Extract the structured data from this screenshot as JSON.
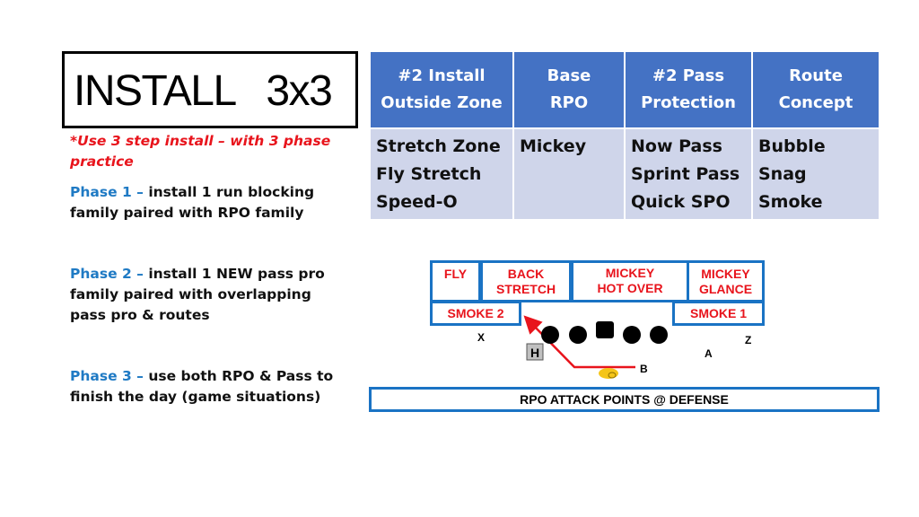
{
  "title": "INSTALL   3x3",
  "notes": {
    "intro": "*Use 3 step install – with 3 phase practice",
    "phases": [
      {
        "label": "Phase 1 –",
        "text": " install 1 run blocking family paired with RPO family"
      },
      {
        "label": "Phase 2 –",
        "text": " install 1 NEW pass pro family paired with overlapping pass pro & routes"
      },
      {
        "label": "Phase 3 –",
        "text": " use both RPO & Pass to finish the day (game situations)"
      }
    ]
  },
  "table": {
    "headers": [
      [
        "#2 Install",
        "Outside Zone"
      ],
      [
        "Base",
        "RPO"
      ],
      [
        "#2 Pass",
        "Protection"
      ],
      [
        "Route",
        "Concept"
      ]
    ],
    "cells": [
      [
        "Stretch Zone",
        "Fly Stretch",
        "Speed-O"
      ],
      [
        "Mickey"
      ],
      [
        "Now Pass",
        "Sprint Pass",
        "Quick SPO"
      ],
      [
        "Bubble",
        "Snag",
        "Smoke"
      ]
    ]
  },
  "diagram": {
    "boxes": {
      "fly": "FLY",
      "back_stretch": "BACK\nSTRETCH",
      "mickey_hot_over": "MICKEY\nHOT OVER",
      "mickey_glance": "MICKEY\nGLANCE",
      "smoke_2": "SMOKE 2",
      "smoke_1": "SMOKE 1"
    },
    "players": {
      "x": "X",
      "h": "H",
      "b": "B",
      "a": "A",
      "z": "Z"
    },
    "banner": "RPO ATTACK POINTS @ DEFENSE",
    "colors": {
      "box_border": "#1a73c4",
      "box_text": "#e8141c",
      "route": "#e8141c",
      "back": "#f5c518"
    }
  }
}
